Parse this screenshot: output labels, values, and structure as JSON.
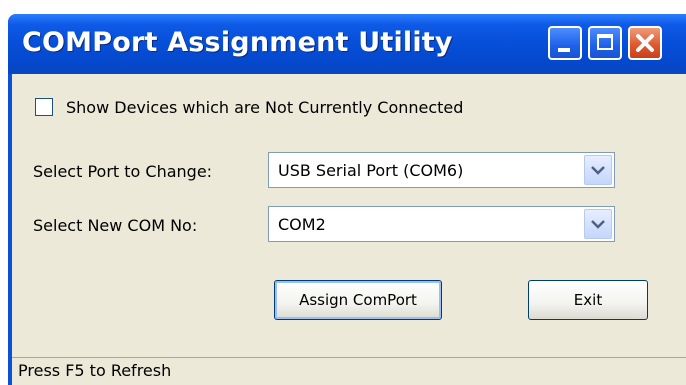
{
  "window": {
    "title": "COMPort Assignment Utility"
  },
  "titlebar_buttons": {
    "minimize_icon": "minimize-icon",
    "maximize_icon": "maximize-icon",
    "close_icon": "close-icon"
  },
  "options": {
    "show_disconnected_label": "Show Devices which are Not Currently Connected",
    "show_disconnected_checked": false
  },
  "port_select": {
    "label": "Select Port to Change:",
    "value": "USB Serial Port (COM6)"
  },
  "com_select": {
    "label": "Select New COM No:",
    "value": "COM2"
  },
  "buttons": {
    "assign_label": "Assign ComPort",
    "exit_label": "Exit"
  },
  "status": {
    "text": "Press F5 to Refresh"
  },
  "colors": {
    "titlebar": "#0750da",
    "client_bg": "#ece9d8",
    "close_button": "#e05a30"
  }
}
